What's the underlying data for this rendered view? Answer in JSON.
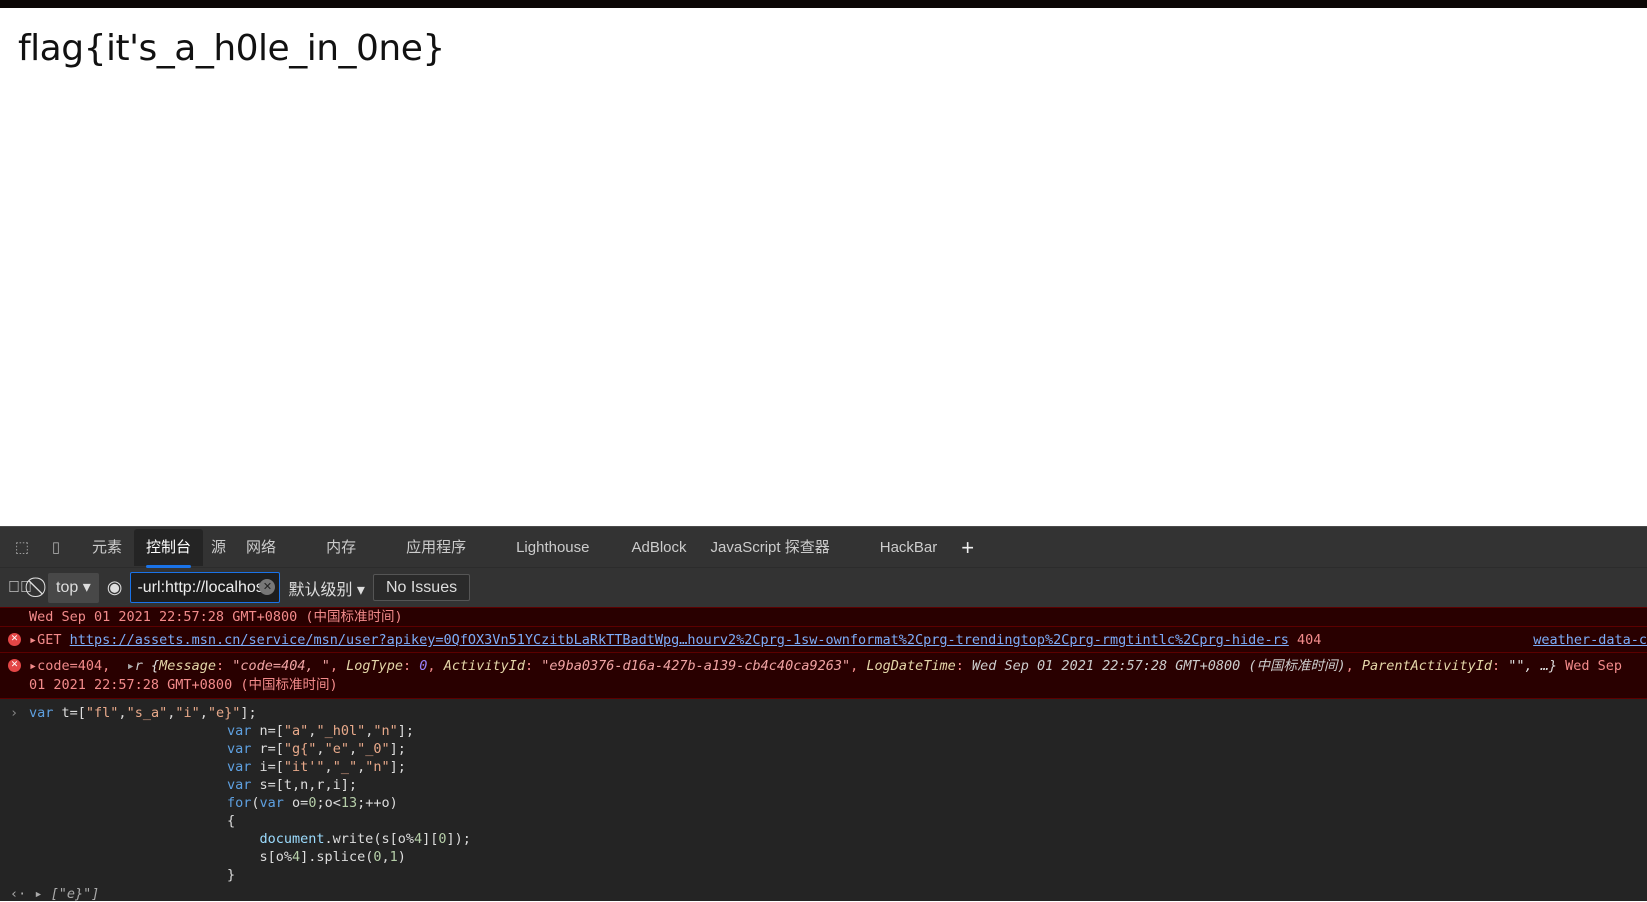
{
  "page": {
    "flag_text": "flag{it's_a_h0le_in_0ne}"
  },
  "devtools": {
    "tabs": [
      "元素",
      "控制台",
      "源",
      "网络",
      "内存",
      "应用程序",
      "Lighthouse",
      "AdBlock",
      "JavaScript 探查器",
      "HackBar"
    ],
    "active_tab": "控制台",
    "toolbar": {
      "context": "top",
      "filter_value": "-url:http://localhos",
      "level": "默认级别",
      "issues": "No Issues"
    },
    "console": {
      "date_line": "Wed Sep 01 2021 22:57:28 GMT+0800 (中国标准时间)",
      "get": {
        "method": "GET",
        "url": "https://assets.msn.cn/service/msn/user?apikey=0QfOX3Vn51YCzitbLaRkTTBadtWpg…hourv2%2Cprg-1sw-ownformat%2Cprg-trendingtop%2Cprg-rmgtintlc%2Cprg-hide-rs",
        "status": "404",
        "source": "weather-data-c"
      },
      "code": {
        "prefix": "code=404,",
        "obj_name": "r",
        "k1": "Message",
        "v1": "\"code=404, \"",
        "k2": "LogType",
        "v2": "0",
        "k3": "ActivityId",
        "v3": "\"e9ba0376-d16a-427b-a139-cb4c40ca9263\"",
        "k4": "LogDateTime",
        "v4": "Wed Sep 01 2021 22:57:28 GMT+0800 (中国标准时间)",
        "k5": "ParentActivityId",
        "v5": "\"\", …}",
        "tail": "Wed Sep",
        "line2": "01 2021 22:57:28 GMT+0800 (中国标准时间)"
      },
      "code_lines": [
        "var t=[\"fl\",\"s_a\",\"i\",\"e}\"];",
        "var n=[\"a\",\"_h0l\",\"n\"];",
        "var r=[\"g{\",\"e\",\"_0\"];",
        "var i=[\"it'\",\"_\",\"n\"];",
        "var s=[t,n,r,i];",
        "for(var o=0;o<13;++o)",
        "{",
        "    document.write(s[o%4][0]);",
        "    s[o%4].splice(0,1)",
        "}"
      ],
      "result": "▸ [\"e}\"]"
    }
  }
}
